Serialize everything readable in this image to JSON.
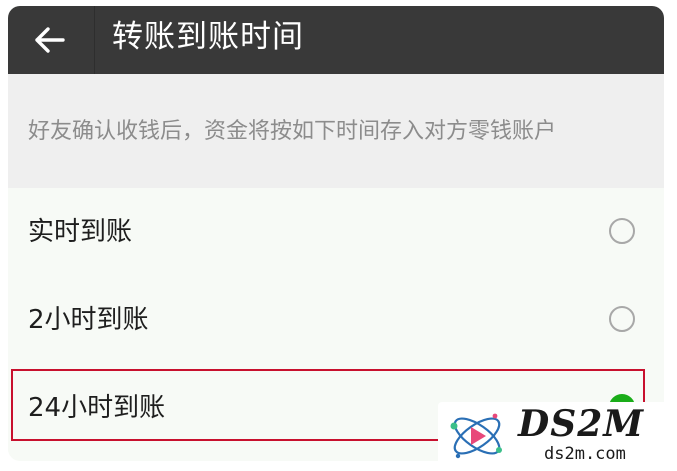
{
  "header": {
    "title": "转账到账时间",
    "back_icon": "arrow-left-icon"
  },
  "description": "好友确认收钱后，资金将按如下时间存入对方零钱账户",
  "options": [
    {
      "label": "实时到账",
      "selected": false
    },
    {
      "label": "2小时到账",
      "selected": false
    },
    {
      "label": "24小时到账",
      "selected": true
    }
  ],
  "colors": {
    "header_bg": "#393939",
    "accent_green": "#1aad19",
    "highlight_red": "#c8102e"
  },
  "watermark": {
    "main": "DS2M",
    "sub": "ds2m.com"
  }
}
